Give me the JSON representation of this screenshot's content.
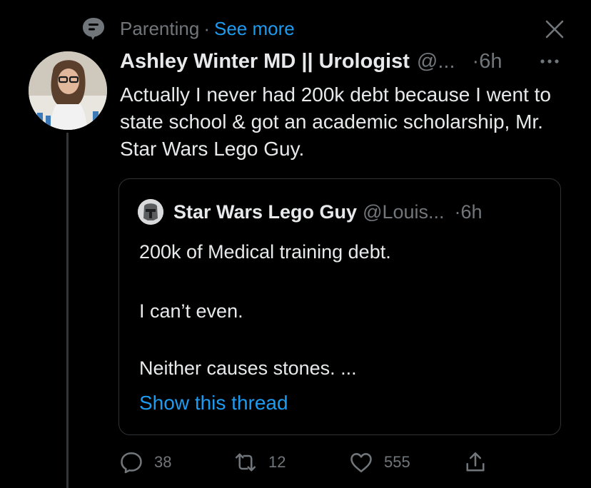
{
  "context": {
    "community": "Parenting",
    "separator": "·",
    "see_more": "See more"
  },
  "tweet": {
    "author_name": "Ashley Winter MD || Urologist",
    "handle": "@...",
    "separator": "·",
    "time": "6h",
    "text": "Actually I never had 200k debt because I went to state school & got an academic scholarship, Mr. Star Wars Lego Guy."
  },
  "quote": {
    "author_name": "Star Wars Lego Guy",
    "handle": "@Louis...",
    "separator": "·",
    "time": "6h",
    "lines": [
      "200k of Medical training debt.",
      "I can’t even.",
      "Neither causes stones. ..."
    ],
    "show_thread": "Show this thread"
  },
  "actions": {
    "replies": "38",
    "retweets": "12",
    "likes": "555"
  },
  "colors": {
    "background": "#000000",
    "text": "#e7e9ea",
    "muted": "#71767b",
    "link": "#1d9bf0",
    "border": "#2f3336"
  },
  "icons": {
    "context": "community-icon",
    "close": "close-icon",
    "more": "more-dots-icon",
    "reply": "reply-icon",
    "retweet": "retweet-icon",
    "like": "heart-icon",
    "share": "share-icon"
  }
}
